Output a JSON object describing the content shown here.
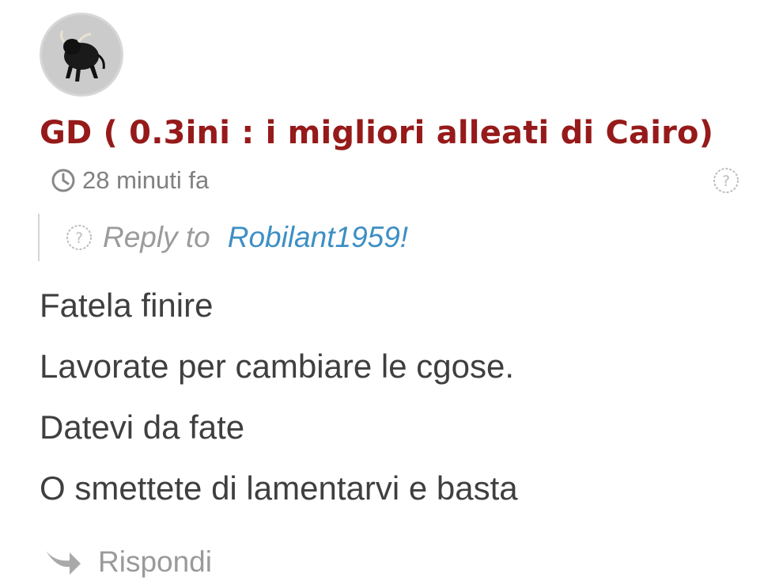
{
  "comment": {
    "author": "GD ( 0.3ini : i migliori alleati di Cairo)",
    "time": "28 minuti fa",
    "reply_to_label": "Reply to",
    "reply_to_user": "Robilant1959!",
    "body_lines": [
      "Fatela finire",
      "Lavorate per cambiare le cgose.",
      "Datevi da fate",
      "O smettete di lamentarvi e basta"
    ],
    "reply_button_label": "Rispondi",
    "icons": {
      "avatar": "bull-avatar",
      "time": "clock-icon",
      "help": "question-circle-icon",
      "reply": "reply-arrow-icon"
    },
    "colors": {
      "author": "#961a1a",
      "link": "#3d8fc5",
      "body_text": "#3f3f3f",
      "muted": "#808080"
    }
  }
}
